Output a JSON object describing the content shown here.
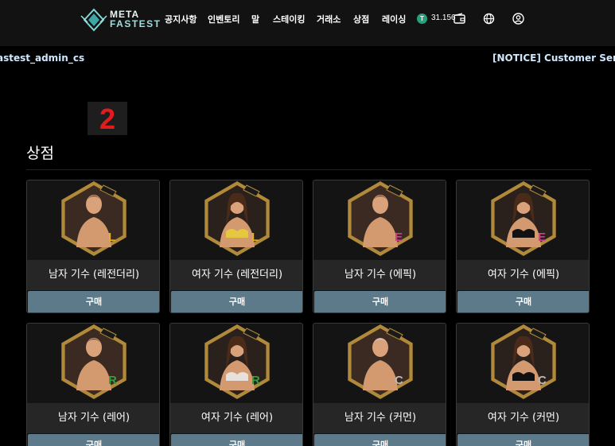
{
  "header": {
    "logo_line1": "META",
    "logo_line2": "FASTEST",
    "nav": [
      "공지사항",
      "인벤토리",
      "말",
      "스테이킹",
      "거래소",
      "상점",
      "레이싱"
    ],
    "token_symbol": "T",
    "balance": "31.156",
    "icons": [
      "wallet-icon",
      "globe-icon",
      "user-icon"
    ]
  },
  "ticker": {
    "left": "astest_admin_cs",
    "right": "[NOTICE] Customer Service"
  },
  "page": {
    "title": "상점"
  },
  "products": [
    {
      "name": "남자 기수 (레전더리)",
      "buy_label": "구매",
      "grade": "L",
      "grade_color": "#e0b020",
      "gender": "male"
    },
    {
      "name": "여자 기수 (레전더리)",
      "buy_label": "구매",
      "grade": "L",
      "grade_color": "#e0b020",
      "gender": "female"
    },
    {
      "name": "남자 기수 (에픽)",
      "buy_label": "구매",
      "grade": "E",
      "grade_color": "#d04090",
      "gender": "male"
    },
    {
      "name": "여자 기수 (에픽)",
      "buy_label": "구매",
      "grade": "E",
      "grade_color": "#d04090",
      "gender": "female"
    },
    {
      "name": "남자 기수 (레어)",
      "buy_label": "구매",
      "grade": "R",
      "grade_color": "#30a040",
      "gender": "male"
    },
    {
      "name": "여자 기수 (레어)",
      "buy_label": "구매",
      "grade": "R",
      "grade_color": "#30a040",
      "gender": "female"
    },
    {
      "name": "남자 기수 (커먼)",
      "buy_label": "구매",
      "grade": "C",
      "grade_color": "#b8b8b8",
      "gender": "male"
    },
    {
      "name": "여자 기수 (커먼)",
      "buy_label": "구매",
      "grade": "C",
      "grade_color": "#b8b8b8",
      "gender": "female"
    }
  ],
  "overlay_number": "2"
}
